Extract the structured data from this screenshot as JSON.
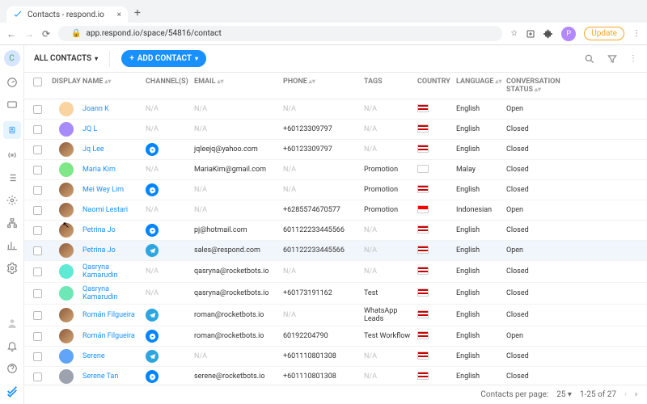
{
  "browser": {
    "tab_title": "Contacts - respond.io",
    "url": "app.respond.io/space/54816/contact",
    "update": "Update",
    "profile_initial": "P"
  },
  "workspace": {
    "initial": "C"
  },
  "toolbar": {
    "filter": "ALL CONTACTS",
    "add": "ADD CONTACT"
  },
  "headers": {
    "display": "DISPLAY",
    "name": "NAME",
    "channels": "CHANNEL(S)",
    "email": "EMAIL",
    "phone": "PHONE",
    "tags": "TAGS",
    "country": "COUNTRY",
    "language": "LANGUAGE",
    "status": "CONVERSATION STATUS"
  },
  "rows": [
    {
      "name": "Joann K",
      "chan": "",
      "email": "N/A",
      "phone": "N/A",
      "tags": "N/A",
      "flag": "my",
      "lang": "English",
      "status": "Open",
      "av": "#f9d4a0"
    },
    {
      "name": "JQ L",
      "chan": "",
      "email": "N/A",
      "phone": "+60123309797",
      "tags": "N/A",
      "flag": "my",
      "lang": "English",
      "status": "Closed",
      "av": "#a78bfa"
    },
    {
      "name": "Jq Lee",
      "chan": "fb",
      "email": "jqleejq@yahoo.com",
      "phone": "+60123309797",
      "tags": "N/A",
      "flag": "my",
      "lang": "English",
      "status": "Closed",
      "av": "photo1"
    },
    {
      "name": "Maria Kim",
      "chan": "",
      "email": "MariaKim@gmail.com",
      "phone": "N/A",
      "tags": "Promotion",
      "flag": "kr",
      "lang": "Malay",
      "status": "Closed",
      "av": "#7ee787"
    },
    {
      "name": "Mei Wey Lim",
      "chan": "fb",
      "email": "N/A",
      "phone": "N/A",
      "tags": "Promotion",
      "flag": "my",
      "lang": "English",
      "status": "Closed",
      "av": "photo2"
    },
    {
      "name": "Naomi Lestari",
      "chan": "",
      "email": "N/A",
      "phone": "+6285574670577",
      "tags": "Promotion",
      "flag": "id",
      "lang": "Indonesian",
      "status": "Open",
      "av": "photo3"
    },
    {
      "name": "Petrina Jo",
      "chan": "fb",
      "email": "pj@hotmail.com",
      "phone": "601122233445566",
      "tags": "N/A",
      "flag": "my",
      "lang": "English",
      "status": "Closed",
      "av": "photo4"
    },
    {
      "name": "Petrina Jo",
      "chan": "tg",
      "email": "sales@respond.com",
      "phone": "601122233445566",
      "tags": "N/A",
      "flag": "my",
      "lang": "English",
      "status": "Open",
      "av": "photo5",
      "hover": true
    },
    {
      "name": "Qasryna Kamarudin",
      "chan": "",
      "email": "qasryna@rocketbots.io",
      "phone": "N/A",
      "tags": "N/A",
      "flag": "my",
      "lang": "English",
      "status": "Closed",
      "av": "#5eead4"
    },
    {
      "name": "Qasryna Kamarudin",
      "chan": "",
      "email": "qasryna@rocketbots.io",
      "phone": "+60173191162",
      "tags": "Test",
      "flag": "my",
      "lang": "English",
      "status": "Closed",
      "av": "#6ee7b7"
    },
    {
      "name": "Román Filgueira",
      "chan": "tg",
      "email": "roman@rocketbots.io",
      "phone": "N/A",
      "tags": "WhatsApp Leads",
      "flag": "my",
      "lang": "English",
      "status": "Closed",
      "av": "photo6"
    },
    {
      "name": "Román Filgueira",
      "chan": "fb",
      "email": "roman@rocketbots.io",
      "phone": "60192204790",
      "tags": "Test Workflow",
      "flag": "my",
      "lang": "English",
      "status": "Open",
      "av": "photo7"
    },
    {
      "name": "Serene",
      "chan": "tg",
      "email": "N/A",
      "phone": "+601110801308",
      "tags": "N/A",
      "flag": "my",
      "lang": "English",
      "status": "Closed",
      "av": "#60a5fa"
    },
    {
      "name": "Serene Tan",
      "chan": "fb",
      "email": "serene@rocketbots.io",
      "phone": "+601110801308",
      "tags": "N/A",
      "flag": "my",
      "lang": "English",
      "status": "Closed",
      "av": "#9ca3af"
    }
  ],
  "footer": {
    "label": "Contacts per page:",
    "size": "25",
    "range": "1-25 of 27"
  }
}
